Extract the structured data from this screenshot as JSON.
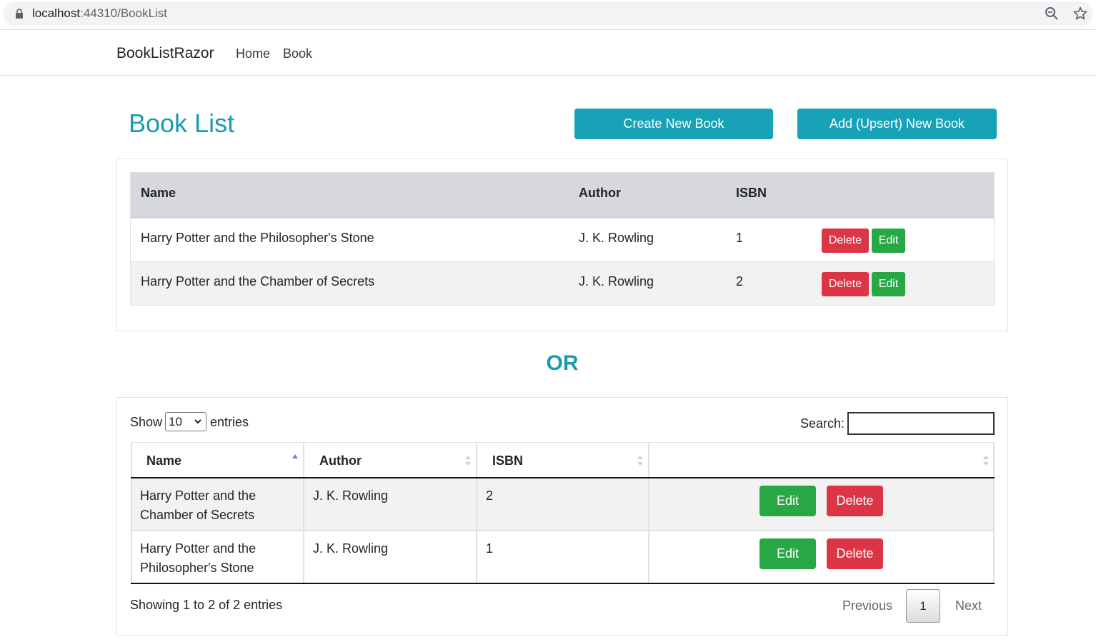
{
  "browser": {
    "url_host": "localhost",
    "url_rest": ":44310/BookList"
  },
  "navbar": {
    "brand": "BookListRazor",
    "links": [
      "Home",
      "Book"
    ]
  },
  "header": {
    "title": "Book List",
    "create_button": "Create New Book",
    "upsert_button": "Add (Upsert) New Book"
  },
  "table1": {
    "headers": [
      "Name",
      "Author",
      "ISBN"
    ],
    "rows": [
      {
        "name": "Harry Potter and the Philosopher's Stone",
        "author": "J. K. Rowling",
        "isbn": "1"
      },
      {
        "name": "Harry Potter and the Chamber of Secrets",
        "author": "J. K. Rowling",
        "isbn": "2"
      }
    ],
    "delete_label": "Delete",
    "edit_label": "Edit"
  },
  "separator": "OR",
  "datatable": {
    "show_label": "Show",
    "page_length": "10",
    "entries_label": "entries",
    "search_label": "Search:",
    "search_value": "",
    "headers": [
      "Name",
      "Author",
      "ISBN",
      ""
    ],
    "rows": [
      {
        "name_line1": "Harry Potter and the",
        "name_line2": "Chamber of Secrets",
        "author": "J. K. Rowling",
        "isbn": "2"
      },
      {
        "name_line1": "Harry Potter and the",
        "name_line2": "Philosopher's Stone",
        "author": "J. K. Rowling",
        "isbn": "1"
      }
    ],
    "edit_label": "Edit",
    "delete_label": "Delete",
    "info": "Showing 1 to 2 of 2 entries",
    "pagination": {
      "previous": "Previous",
      "current": "1",
      "next": "Next"
    }
  },
  "colors": {
    "accent": "#17a2b8",
    "title": "#1a9bb0",
    "danger": "#dc3545",
    "success": "#28a745"
  }
}
